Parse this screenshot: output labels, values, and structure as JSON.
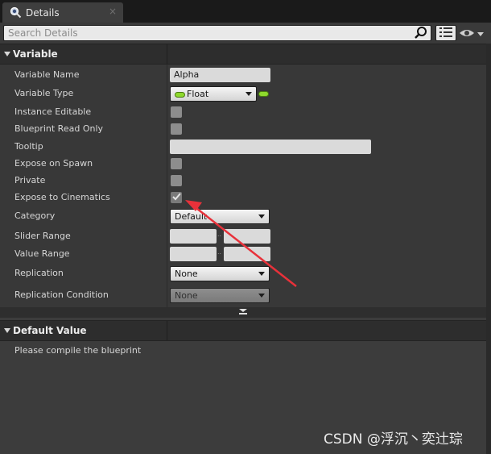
{
  "tab": {
    "title": "Details",
    "icon": "magnifier-details-icon",
    "close": "×"
  },
  "search": {
    "placeholder": "Search Details"
  },
  "sections": {
    "variable": {
      "title": "Variable"
    },
    "default_value": {
      "title": "Default Value",
      "message": "Please compile the blueprint"
    }
  },
  "properties": {
    "variable_name": {
      "label": "Variable Name",
      "value": "Alpha"
    },
    "variable_type": {
      "label": "Variable Type",
      "value": "Float"
    },
    "instance_editable": {
      "label": "Instance Editable",
      "checked": false
    },
    "blueprint_read_only": {
      "label": "Blueprint Read Only",
      "checked": false
    },
    "tooltip": {
      "label": "Tooltip",
      "value": ""
    },
    "expose_on_spawn": {
      "label": "Expose on Spawn",
      "checked": false
    },
    "private": {
      "label": "Private",
      "checked": false
    },
    "expose_to_cinematics": {
      "label": "Expose to Cinematics",
      "checked": true
    },
    "category": {
      "label": "Category",
      "value": "Default"
    },
    "slider_range": {
      "label": "Slider Range",
      "min": "",
      "max": "",
      "separator": ".."
    },
    "value_range": {
      "label": "Value Range",
      "min": "",
      "max": "",
      "separator": ".."
    },
    "replication": {
      "label": "Replication",
      "value": "None"
    },
    "replication_condition": {
      "label": "Replication Condition",
      "value": "None"
    }
  },
  "colors": {
    "float_pin": "#8ed92d",
    "annotation_arrow": "#e8313a"
  },
  "watermark": "CSDN @浮沉丶奕辻琮"
}
